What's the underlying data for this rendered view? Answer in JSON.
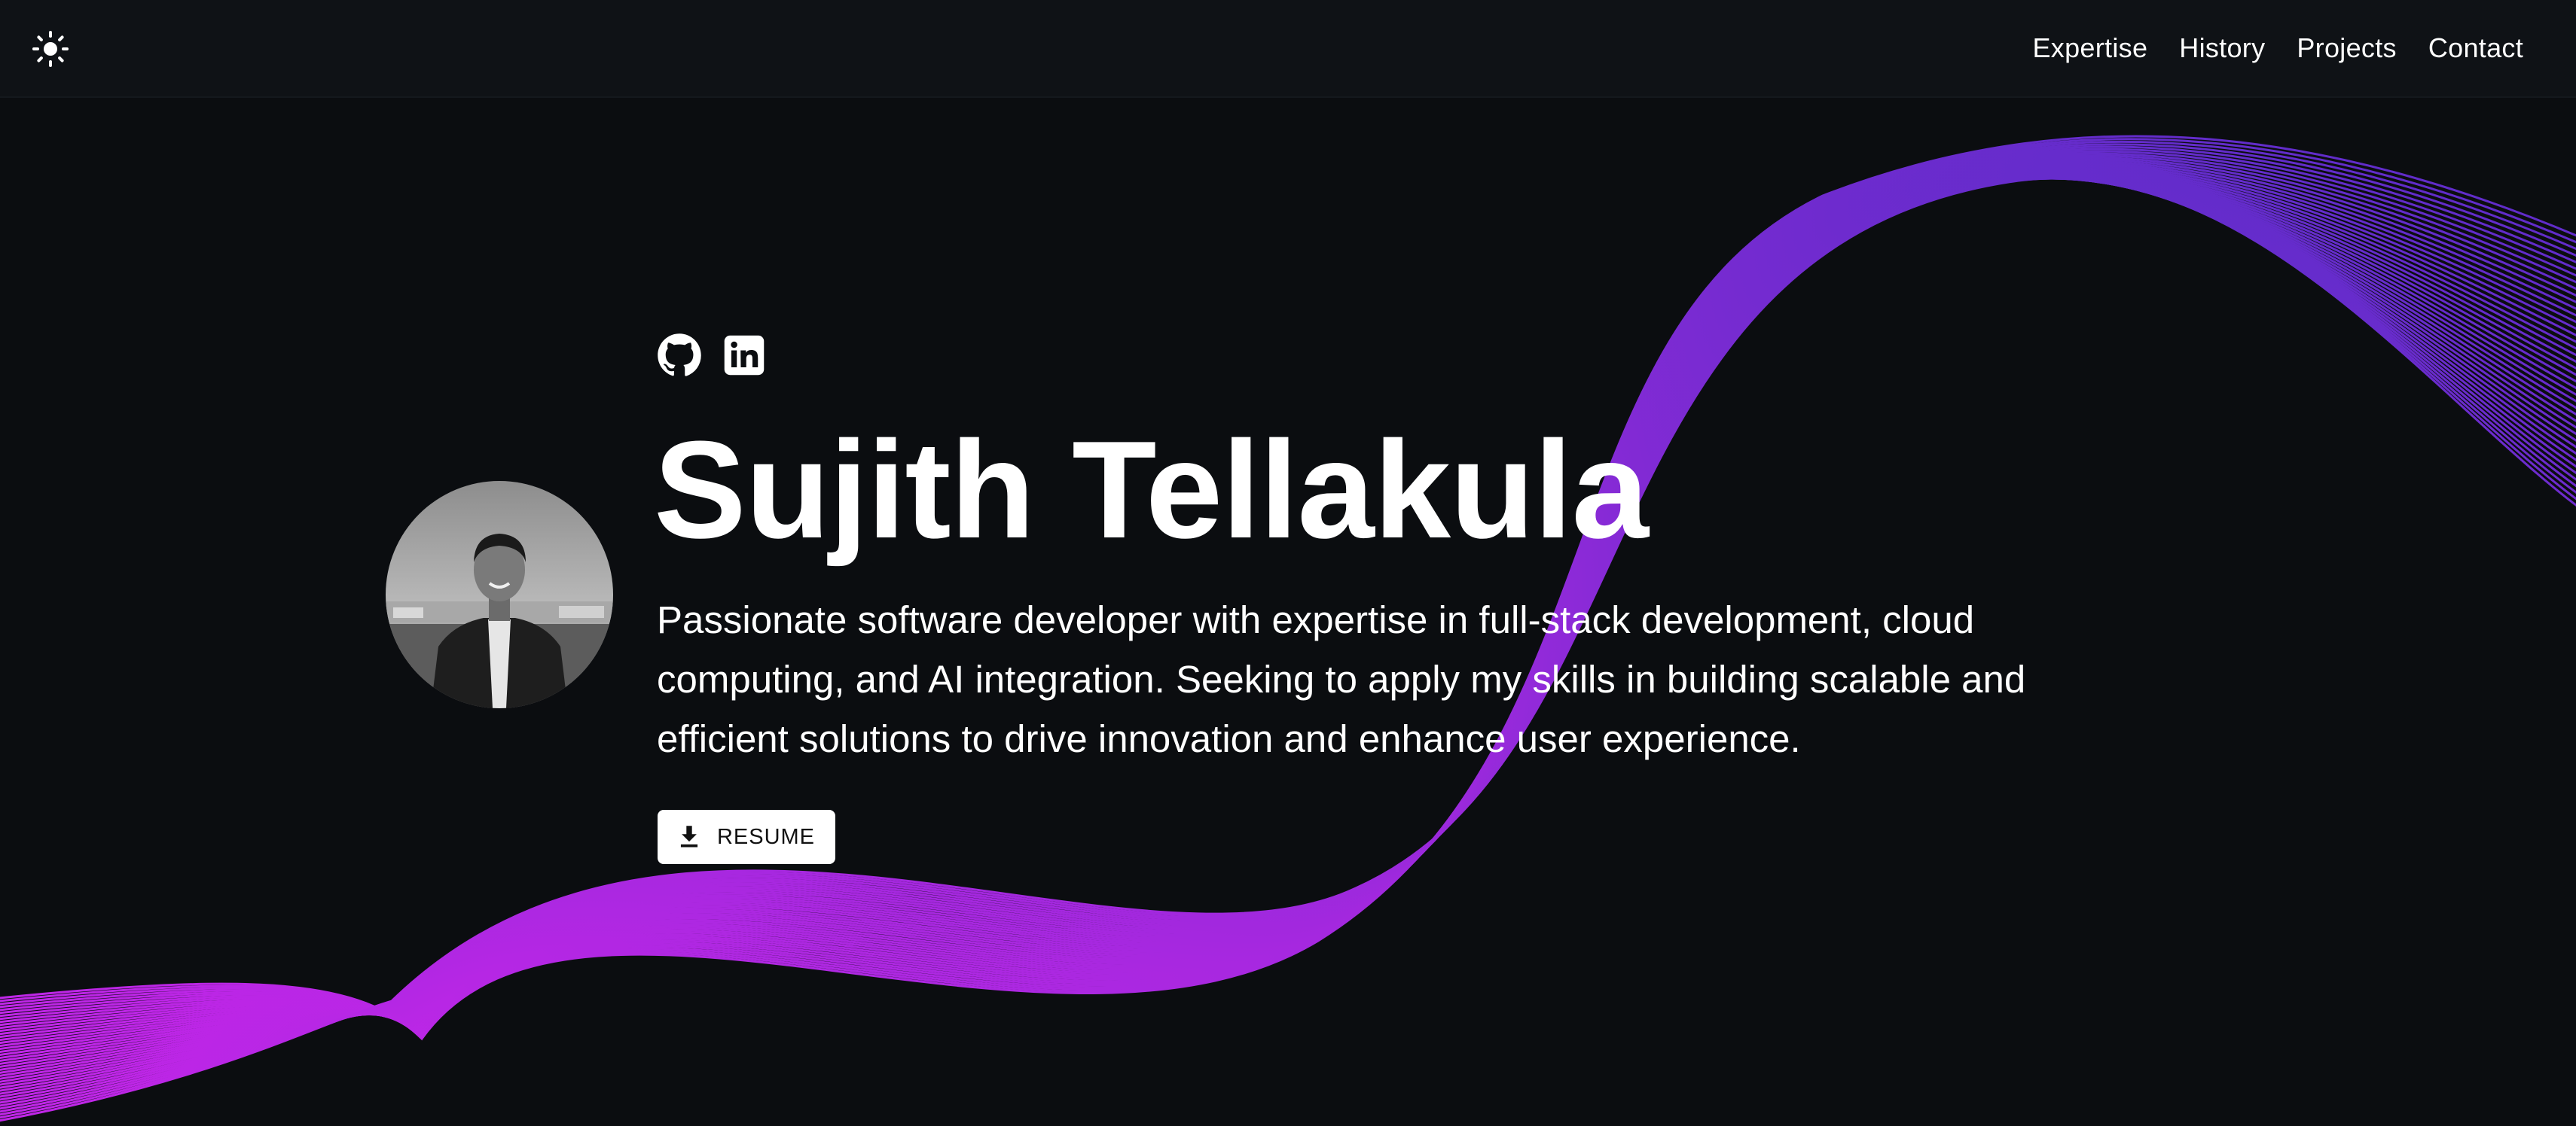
{
  "nav": {
    "theme_toggle_icon": "sun-icon",
    "links": [
      "Expertise",
      "History",
      "Projects",
      "Contact"
    ]
  },
  "hero": {
    "social_icons": [
      "github-icon",
      "linkedin-icon"
    ],
    "name": "Sujith Tellakula",
    "tagline": "Passionate software developer with expertise in full-stack development, cloud computing, and AI integration. Seeking to apply my skills in building scalable and efficient solutions to drive innovation and enhance user experience.",
    "resume_label": "RESUME",
    "resume_icon": "download-icon"
  },
  "colors": {
    "background": "#0b0d10",
    "topbar": "#0f1216",
    "text": "#ffffff",
    "wave_start": "#b526e6",
    "wave_end": "#5a2cc8",
    "button_bg": "#ffffff"
  }
}
